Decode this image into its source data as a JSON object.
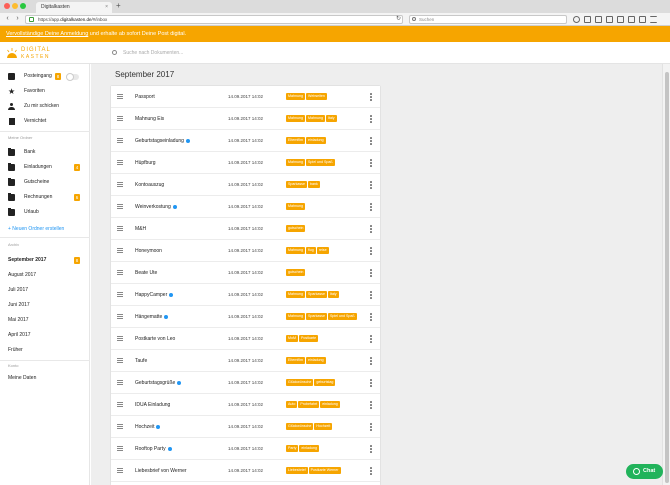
{
  "browser": {
    "tab_title": "Digitalkasten",
    "tab_close": "×",
    "new_tab": "+",
    "url_prefix": "https://app.",
    "url_host": "digitalkasten.de",
    "url_path": "/#/inbox",
    "search_placeholder": "Suchen"
  },
  "banner": {
    "link_text": "Vervollständige Deine Anmeldung",
    "rest_text": " und erhalte ab sofort Deine Post digital."
  },
  "app": {
    "logo_top": "DIGITAL",
    "logo_bottom": "KASTEN",
    "search_placeholder": "Suche nach Dokumenten..."
  },
  "sidebar": {
    "inbox_label": "Posteingang",
    "inbox_badge": "8",
    "favorites_label": "Favoriten",
    "send_to_me_label": "Zu mir schicken",
    "destroyed_label": "Vernichtet",
    "folders_heading": "Meine Ordner",
    "folders": [
      {
        "label": "Bank",
        "badge": ""
      },
      {
        "label": "Einladungen",
        "badge": "4"
      },
      {
        "label": "Gutscheine",
        "badge": ""
      },
      {
        "label": "Rechnungen",
        "badge": "6"
      },
      {
        "label": "Urlaub",
        "badge": ""
      }
    ],
    "new_folder_label": "+ Neuen Ordner erstellen",
    "archive_heading": "Archiv",
    "months": [
      {
        "label": "September 2017",
        "badge": "8"
      },
      {
        "label": "August 2017",
        "badge": ""
      },
      {
        "label": "Juli 2017",
        "badge": ""
      },
      {
        "label": "Juni 2017",
        "badge": ""
      },
      {
        "label": "Mai 2017",
        "badge": ""
      },
      {
        "label": "April 2017",
        "badge": ""
      },
      {
        "label": "Früher",
        "badge": ""
      }
    ],
    "account_heading": "Konto",
    "my_data_label": "Meine Daten"
  },
  "main": {
    "month_title": "September 2017",
    "documents": [
      {
        "name": "Passport",
        "unread": false,
        "date": "14.09.2017 14:02",
        "tags": [
          "Mahnung",
          "Webseiten"
        ]
      },
      {
        "name": "Mahnung Eis",
        "unread": false,
        "date": "14.09.2017 14:02",
        "tags": [
          "Mahnung",
          "Mahnung",
          "Italy"
        ]
      },
      {
        "name": "Geburtstagseinladung",
        "unread": true,
        "date": "14.09.2017 14:02",
        "tags": [
          "Elternfilm",
          "einladung"
        ]
      },
      {
        "name": "Hüpfburg",
        "unread": false,
        "date": "14.09.2017 14:02",
        "tags": [
          "Mahnung",
          "Spiel und Spaß"
        ]
      },
      {
        "name": "Kontoauszug",
        "unread": false,
        "date": "14.09.2017 14:02",
        "tags": [
          "Sparkasse",
          "bank"
        ]
      },
      {
        "name": "Weinverkostung",
        "unread": true,
        "date": "14.09.2017 14:02",
        "tags": [
          "Mahnung"
        ]
      },
      {
        "name": "M&H",
        "unread": false,
        "date": "14.09.2017 14:02",
        "tags": [
          "gutschein"
        ]
      },
      {
        "name": "Honeymoon",
        "unread": false,
        "date": "14.09.2017 14:02",
        "tags": [
          "Mahnung",
          "flug",
          "reise"
        ]
      },
      {
        "name": "Beate Ute",
        "unread": false,
        "date": "14.09.2017 14:02",
        "tags": [
          "gutschein"
        ]
      },
      {
        "name": "HappyCamper",
        "unread": true,
        "date": "14.09.2017 14:02",
        "tags": [
          "Mahnung",
          "Sparkasse",
          "Italy"
        ]
      },
      {
        "name": "Hängematte",
        "unread": true,
        "date": "14.09.2017 14:02",
        "tags": [
          "Mahnung",
          "Sparkasse",
          "Spiel und Spaß"
        ]
      },
      {
        "name": "Postkarte von Leo",
        "unread": false,
        "date": "14.09.2017 14:02",
        "tags": [
          "MoM",
          "Postkarte"
        ]
      },
      {
        "name": "Taufe",
        "unread": false,
        "date": "14.09.2017 14:02",
        "tags": [
          "Elternfilm",
          "einladung"
        ]
      },
      {
        "name": "Geburtstagsgrüße",
        "unread": true,
        "date": "14.09.2017 14:02",
        "tags": [
          "Glückwünsche",
          "geburtstag"
        ]
      },
      {
        "name": "IDUA Einladung",
        "unread": false,
        "date": "14.09.2017 14:02",
        "tags": [
          "Auto",
          "Probefahrt",
          "einladung"
        ]
      },
      {
        "name": "Hochzeit",
        "unread": true,
        "date": "14.09.2017 14:02",
        "tags": [
          "Glückwünsche",
          "Hochzeit"
        ]
      },
      {
        "name": "Rooftop Party",
        "unread": true,
        "date": "14.09.2017 14:02",
        "tags": [
          "Party",
          "einladung"
        ]
      },
      {
        "name": "Liebesbrief von Werner",
        "unread": false,
        "date": "14.09.2017 14:02",
        "tags": [
          "Liebesbrief",
          "Postkarte Werner"
        ]
      }
    ]
  },
  "chat_label": "Chat",
  "colors": {
    "accent": "#f6a500",
    "unread_dot": "#2196f3",
    "chat": "#21b35b"
  }
}
